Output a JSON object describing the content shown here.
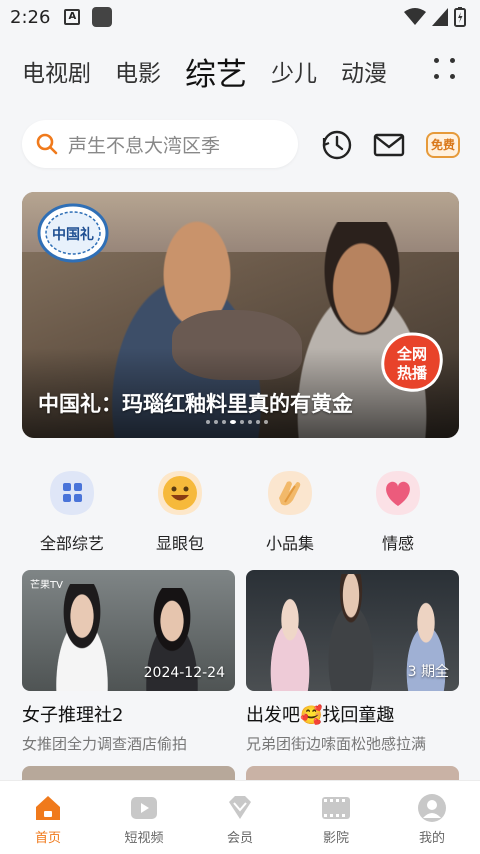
{
  "status_bar": {
    "time": "2:26",
    "notification_letter": "A"
  },
  "tabs": [
    {
      "label": "电视剧",
      "active": false
    },
    {
      "label": "电影",
      "active": false
    },
    {
      "label": "综艺",
      "active": true
    },
    {
      "label": "少儿",
      "active": false
    },
    {
      "label": "动漫",
      "active": false
    }
  ],
  "search": {
    "placeholder": "声生不息大湾区季"
  },
  "header_actions": {
    "free_badge": "免费"
  },
  "banner": {
    "title": "中国礼：玛瑙红釉料里真的有黄金",
    "logo_text": "中国礼",
    "badge_text_1": "全网",
    "badge_text_2": "热播",
    "page_count": 8,
    "active_page": 3
  },
  "shortcuts": [
    {
      "label": "全部综艺",
      "icon": "grid-icon"
    },
    {
      "label": "显眼包",
      "icon": "smiley-icon"
    },
    {
      "label": "小品集",
      "icon": "clap-icon"
    },
    {
      "label": "情感",
      "icon": "heart-icon"
    }
  ],
  "cards": [
    {
      "title": "女子推理社2",
      "subtitle": "女推团全力调查酒店偷拍",
      "thumb_label": "2024-12-24",
      "channel_mark": "芒果TV"
    },
    {
      "title": "出发吧🥰找回童趣",
      "subtitle": "兄弟团街边嗦面松弛感拉满",
      "thumb_label": "3 期全"
    }
  ],
  "bottom_nav": [
    {
      "label": "首页",
      "icon": "home-icon",
      "active": true
    },
    {
      "label": "短视频",
      "icon": "play-icon",
      "active": false
    },
    {
      "label": "会员",
      "icon": "diamond-icon",
      "active": false
    },
    {
      "label": "影院",
      "icon": "film-icon",
      "active": false
    },
    {
      "label": "我的",
      "icon": "profile-icon",
      "active": false
    }
  ],
  "colors": {
    "accent": "#f07a1c",
    "background": "#f5f6f8"
  }
}
